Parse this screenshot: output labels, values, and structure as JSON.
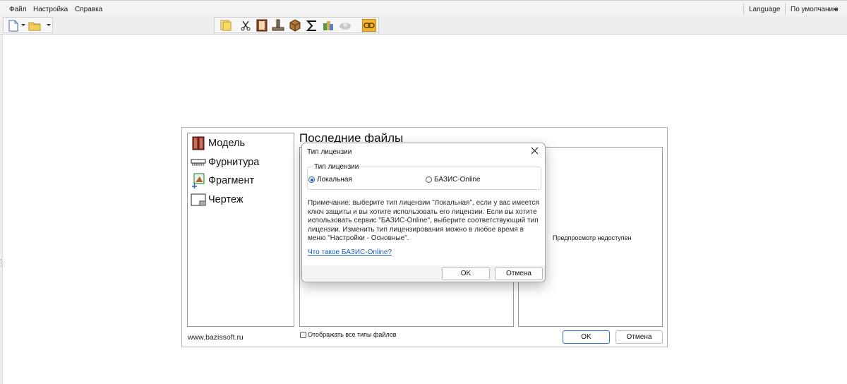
{
  "menubar": {
    "file": "Файл",
    "settings": "Настройка",
    "help": "Справка",
    "language": "Language",
    "default_mode": "По умолчанию"
  },
  "toolbar": {
    "icons": [
      "new-file-icon",
      "open-folder-icon",
      "open-project-icon",
      "scissors-icon",
      "cabinet-icon",
      "anvil-icon",
      "box-icon",
      "sigma-icon",
      "materials-icon",
      "cloud-icon",
      "link-icon"
    ]
  },
  "start_panel": {
    "nav": [
      {
        "label": "Модель",
        "icon": "cabinet-icon"
      },
      {
        "label": "Фурнитура",
        "icon": "hardware-icon"
      },
      {
        "label": "Фрагмент",
        "icon": "fragment-icon"
      },
      {
        "label": "Чертеж",
        "icon": "drawing-icon"
      }
    ],
    "recent_title": "Последние файлы",
    "preview_text": "Предпросмотр недоступен",
    "site": "www.bazissoft.ru",
    "show_all_label": "Отображать все типы файлов",
    "show_all_checked": false,
    "ok_label": "OK",
    "cancel_label": "Отмена"
  },
  "dialog": {
    "title": "Тип лицензии",
    "group_label": "Тип лицензии",
    "options": [
      {
        "label": "Локальная",
        "selected": true
      },
      {
        "label": "БАЗИС-Online",
        "selected": false
      }
    ],
    "note": "Примечание: выберите тип лицензии \"Локальная\", если у вас имеется ключ защиты и вы хотите использовать его лицензии. Если вы хотите использовать сервис \"БАЗИС-Online\", выберите соответствующий тип лицензии. Изменить тип лицензирования можно в любое время в меню \"Настройки - Основные\".",
    "link": "Что такое БАЗИС-Online?",
    "ok_label": "OK",
    "cancel_label": "Отмена"
  },
  "colors": {
    "accent": "#2a6ed3",
    "link": "#1a5fb4"
  }
}
